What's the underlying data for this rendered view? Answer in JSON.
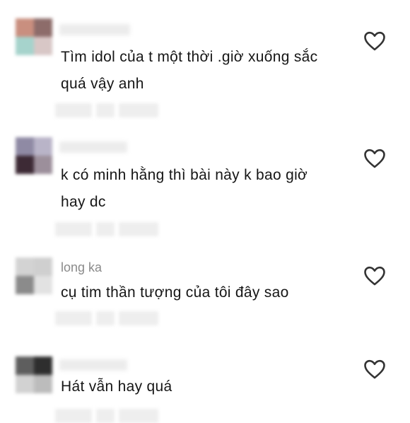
{
  "comments": [
    {
      "username": "",
      "text_line1": "Tìm idol của t một thời .giờ xuống sắc",
      "text_line2": "quá vậy anh",
      "avatar_colors": [
        "#c98f7f",
        "#8d6c6a",
        "#a6d3cc",
        "#d8c7c6"
      ]
    },
    {
      "username": "",
      "text_line1": "k có minh hằng thì bài này k bao giờ",
      "text_line2": "hay dc",
      "avatar_colors": [
        "#8f8aa4",
        "#b9b4c8",
        "#3d2a35",
        "#9c8f9b"
      ]
    },
    {
      "username": "long ka",
      "text_line1": "cụ tim thần tượng của tôi đây sao",
      "text_line2": "",
      "avatar_colors": [
        "#d3d3d3",
        "#cfcfcf",
        "#8b8b8b",
        "#e2e2e2"
      ]
    },
    {
      "username": "",
      "text_line1": "Hát vẫn hay quá",
      "text_line2": "",
      "avatar_colors": [
        "#5e5e5e",
        "#2e2e2e",
        "#d2d2d2",
        "#bcbcbc"
      ]
    }
  ],
  "icons": {
    "like": "heart-outline-icon"
  },
  "colors": {
    "text": "#161616",
    "username": "#8a8a8a",
    "icon": "#333333"
  }
}
